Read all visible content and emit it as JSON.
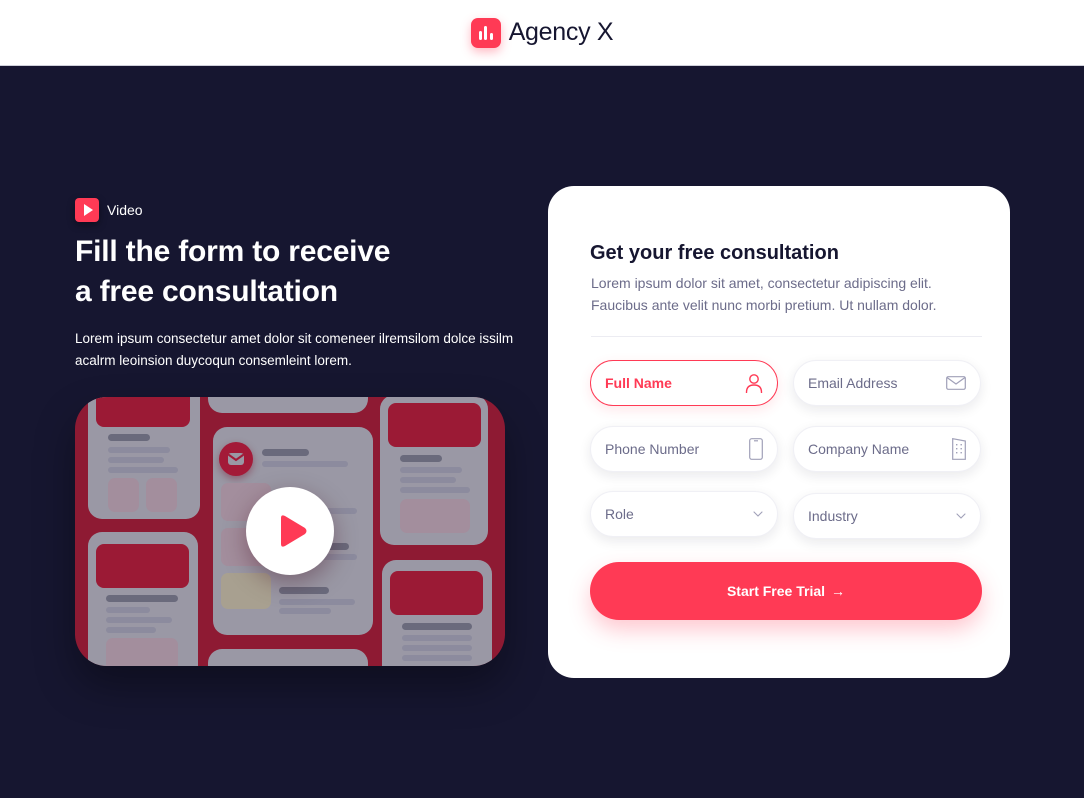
{
  "header": {
    "brand_name": "Agency X",
    "brand_icon": "bar-chart-icon",
    "brand_color": "#ff3a55"
  },
  "hero": {
    "tag_icon": "play-icon",
    "tag_label": "Video",
    "headline_line1": "Fill the form to receive",
    "headline_line2": "a free consultation",
    "lead": "Lorem ipsum consectetur amet dolor sit comeneer ilremsilom dolce issilm acalrm leoinsion duycoqun consemleint lorem.",
    "video": {
      "play_icon": "play-icon",
      "badge_icon": "mail-icon"
    }
  },
  "form": {
    "title": "Get your free consultation",
    "description": "Lorem ipsum dolor sit amet, consectetur adipiscing elit. Faucibus ante velit nunc morbi pretium. Ut nullam dolor.",
    "fields": {
      "full_name": {
        "placeholder": "Full Name",
        "value": "",
        "icon": "user-icon",
        "state": "focused"
      },
      "email": {
        "placeholder": "Email Address",
        "value": "",
        "icon": "envelope-icon"
      },
      "phone": {
        "placeholder": "Phone Number",
        "value": "",
        "icon": "phone-icon"
      },
      "company": {
        "placeholder": "Company Name",
        "value": "",
        "icon": "building-icon"
      },
      "role": {
        "selected": "Role",
        "icon": "chevron-down-icon"
      },
      "industry": {
        "selected": "Industry",
        "icon": "chevron-down-icon"
      }
    },
    "submit_label": "Start Free Trial",
    "submit_arrow": "→",
    "accent_color": "#ff3a55",
    "background_color": "#161630"
  }
}
